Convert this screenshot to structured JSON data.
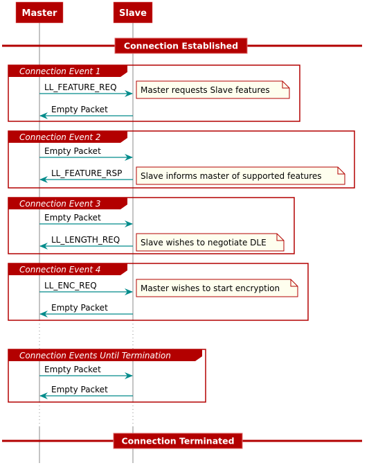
{
  "colors": {
    "accent": "#b30000",
    "arrow": "#008b8b",
    "lifeline": "#888888",
    "note_bg": "#fefeee"
  },
  "participants": [
    {
      "name": "Master"
    },
    {
      "name": "Slave"
    }
  ],
  "dividers": [
    {
      "label": "Connection Established"
    },
    {
      "label": "Connection Terminated"
    }
  ],
  "groups": [
    {
      "title": "Connection Event 1",
      "messages": [
        {
          "from": "Master",
          "to": "Slave",
          "label": "LL_FEATURE_REQ",
          "note": "Master requests Slave features"
        },
        {
          "from": "Slave",
          "to": "Master",
          "label": "Empty Packet",
          "note": ""
        }
      ]
    },
    {
      "title": "Connection Event 2",
      "messages": [
        {
          "from": "Master",
          "to": "Slave",
          "label": "Empty Packet",
          "note": ""
        },
        {
          "from": "Slave",
          "to": "Master",
          "label": "LL_FEATURE_RSP",
          "note": "Slave informs master of supported features"
        }
      ]
    },
    {
      "title": "Connection Event 3",
      "messages": [
        {
          "from": "Master",
          "to": "Slave",
          "label": "Empty Packet",
          "note": ""
        },
        {
          "from": "Slave",
          "to": "Master",
          "label": "LL_LENGTH_REQ",
          "note": "Slave wishes to negotiate DLE"
        }
      ]
    },
    {
      "title": "Connection Event 4",
      "messages": [
        {
          "from": "Master",
          "to": "Slave",
          "label": "LL_ENC_REQ",
          "note": "Master wishes to start encryption"
        },
        {
          "from": "Slave",
          "to": "Master",
          "label": "Empty Packet",
          "note": ""
        }
      ]
    },
    {
      "title": "Connection Events Until Termination",
      "messages": [
        {
          "from": "Master",
          "to": "Slave",
          "label": "Empty Packet",
          "note": ""
        },
        {
          "from": "Slave",
          "to": "Master",
          "label": "Empty Packet",
          "note": ""
        }
      ]
    }
  ]
}
